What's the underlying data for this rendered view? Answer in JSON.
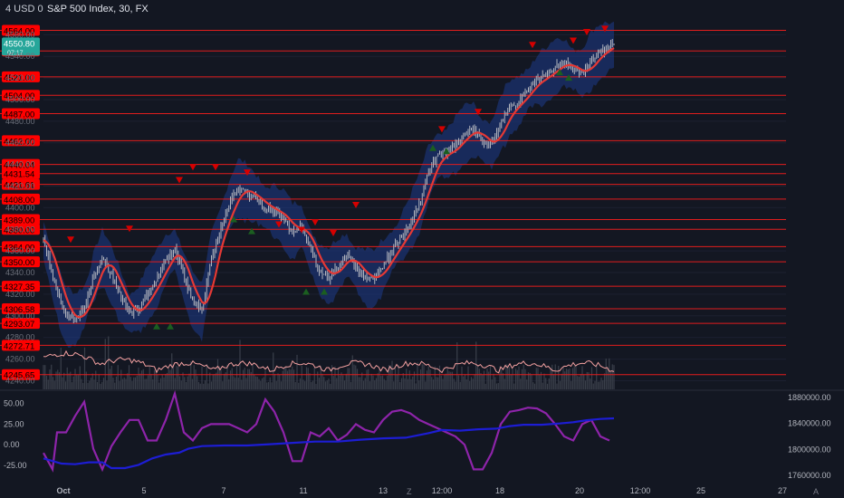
{
  "header": {
    "currency_label": "4 USD 0",
    "title": "S&P 500 Index, 30, FX"
  },
  "price_badge": {
    "value": "4550.80",
    "sub": "07:17"
  },
  "corner_labels": {
    "left": "Z",
    "right": "A"
  },
  "colors": {
    "background": "#131722",
    "level_line": "#e11d1d",
    "level_label_bg": "#ff0000",
    "price_badge_bg": "#26a69a",
    "candles": "#b2b5be",
    "moving_average": "#e53935",
    "band": "#1e3a8a",
    "oscillator": "#8e24aa",
    "volume_line": "#1d1dd4",
    "lower_histogram": "#f3a0a0",
    "marker_up": "#1b5e20",
    "marker_down": "#d50000"
  },
  "chart_data": {
    "type": "line",
    "title": "S&P 500 Index, 30, FX",
    "price_axis": {
      "ticks": [
        "4560.00",
        "4540.00",
        "4520.00",
        "4500.00",
        "4480.00",
        "4460.00",
        "4440.00",
        "4420.00",
        "4400.00",
        "4380.00",
        "4360.00",
        "4340.00",
        "4320.00",
        "4300.00",
        "4280.00",
        "4260.00",
        "4240.00"
      ]
    },
    "time_axis": {
      "ticks": [
        "Oct",
        "5",
        "7",
        "11",
        "13",
        "12:00",
        "18",
        "20",
        "12:00",
        "25",
        "27"
      ]
    },
    "horizontal_levels": [
      4564.0,
      4545.02,
      4521.0,
      4504.0,
      4487.0,
      4462.0,
      4440.04,
      4431.54,
      4421.61,
      4408.0,
      4389.0,
      4380.0,
      4364.0,
      4350.0,
      4327.35,
      4306.58,
      4293.07,
      4272.71,
      4245.65
    ],
    "horizontal_level_labels": [
      "4564.00",
      "4545.02",
      "4521.00",
      "4504.00",
      "4487.00",
      "4462.00",
      "4440.04",
      "4431.54",
      "4421.61",
      "4408.00",
      "4389.00",
      "4380.00",
      "4364.00",
      "4350.00",
      "4327.35",
      "4306.58",
      "4293.07",
      "4272.71",
      "4245.65"
    ],
    "price_series": [
      {
        "t": 0,
        "v": 4370
      },
      {
        "t": 2,
        "v": 4338
      },
      {
        "t": 4,
        "v": 4310
      },
      {
        "t": 5,
        "v": 4300
      },
      {
        "t": 7,
        "v": 4296
      },
      {
        "t": 9,
        "v": 4308
      },
      {
        "t": 11,
        "v": 4336
      },
      {
        "t": 13,
        "v": 4354
      },
      {
        "t": 15,
        "v": 4338
      },
      {
        "t": 17,
        "v": 4318
      },
      {
        "t": 19,
        "v": 4302
      },
      {
        "t": 21,
        "v": 4306
      },
      {
        "t": 23,
        "v": 4320
      },
      {
        "t": 25,
        "v": 4334
      },
      {
        "t": 27,
        "v": 4352
      },
      {
        "t": 29,
        "v": 4362
      },
      {
        "t": 31,
        "v": 4336
      },
      {
        "t": 33,
        "v": 4314
      },
      {
        "t": 35,
        "v": 4304
      },
      {
        "t": 37,
        "v": 4352
      },
      {
        "t": 39,
        "v": 4380
      },
      {
        "t": 41,
        "v": 4402
      },
      {
        "t": 43,
        "v": 4418
      },
      {
        "t": 45,
        "v": 4414
      },
      {
        "t": 47,
        "v": 4408
      },
      {
        "t": 49,
        "v": 4400
      },
      {
        "t": 51,
        "v": 4397
      },
      {
        "t": 53,
        "v": 4390
      },
      {
        "t": 55,
        "v": 4378
      },
      {
        "t": 57,
        "v": 4383
      },
      {
        "t": 59,
        "v": 4360
      },
      {
        "t": 61,
        "v": 4342
      },
      {
        "t": 63,
        "v": 4336
      },
      {
        "t": 65,
        "v": 4346
      },
      {
        "t": 67,
        "v": 4356
      },
      {
        "t": 69,
        "v": 4344
      },
      {
        "t": 71,
        "v": 4336
      },
      {
        "t": 73,
        "v": 4334
      },
      {
        "t": 75,
        "v": 4346
      },
      {
        "t": 77,
        "v": 4360
      },
      {
        "t": 79,
        "v": 4372
      },
      {
        "t": 81,
        "v": 4386
      },
      {
        "t": 83,
        "v": 4404
      },
      {
        "t": 85,
        "v": 4432
      },
      {
        "t": 87,
        "v": 4448
      },
      {
        "t": 89,
        "v": 4450
      },
      {
        "t": 91,
        "v": 4458
      },
      {
        "t": 93,
        "v": 4468
      },
      {
        "t": 95,
        "v": 4472
      },
      {
        "t": 97,
        "v": 4462
      },
      {
        "t": 99,
        "v": 4458
      },
      {
        "t": 101,
        "v": 4478
      },
      {
        "t": 103,
        "v": 4492
      },
      {
        "t": 105,
        "v": 4498
      },
      {
        "t": 107,
        "v": 4510
      },
      {
        "t": 109,
        "v": 4518
      },
      {
        "t": 111,
        "v": 4522
      },
      {
        "t": 113,
        "v": 4530
      },
      {
        "t": 115,
        "v": 4534
      },
      {
        "t": 117,
        "v": 4528
      },
      {
        "t": 119,
        "v": 4524
      },
      {
        "t": 121,
        "v": 4536
      },
      {
        "t": 123,
        "v": 4544
      },
      {
        "t": 125,
        "v": 4549
      },
      {
        "t": 126,
        "v": 4550.8
      }
    ],
    "oscillator_axis": {
      "ticks": [
        "50.00",
        "25.00",
        "0.00",
        "-25.00"
      ],
      "range": [
        -45,
        65
      ]
    },
    "volume_axis": {
      "ticks": [
        "1880000.00",
        "1840000.00",
        "1800000.00",
        "1760000.00"
      ],
      "range": [
        1750000,
        1890000
      ]
    },
    "oscillator_series": [
      {
        "t": 0,
        "v": -10
      },
      {
        "t": 2,
        "v": -30
      },
      {
        "t": 3,
        "v": 15
      },
      {
        "t": 5,
        "v": 15
      },
      {
        "t": 7,
        "v": 35
      },
      {
        "t": 9,
        "v": 52
      },
      {
        "t": 11,
        "v": -5
      },
      {
        "t": 13,
        "v": -30
      },
      {
        "t": 15,
        "v": -2
      },
      {
        "t": 17,
        "v": 15
      },
      {
        "t": 19,
        "v": 30
      },
      {
        "t": 21,
        "v": 30
      },
      {
        "t": 23,
        "v": 5
      },
      {
        "t": 25,
        "v": 5
      },
      {
        "t": 27,
        "v": 30
      },
      {
        "t": 29,
        "v": 62
      },
      {
        "t": 31,
        "v": 15
      },
      {
        "t": 33,
        "v": 5
      },
      {
        "t": 35,
        "v": 20
      },
      {
        "t": 37,
        "v": 25
      },
      {
        "t": 39,
        "v": 25
      },
      {
        "t": 41,
        "v": 25
      },
      {
        "t": 43,
        "v": 20
      },
      {
        "t": 45,
        "v": 15
      },
      {
        "t": 47,
        "v": 25
      },
      {
        "t": 49,
        "v": 55
      },
      {
        "t": 51,
        "v": 40
      },
      {
        "t": 53,
        "v": 15
      },
      {
        "t": 55,
        "v": -20
      },
      {
        "t": 57,
        "v": -20
      },
      {
        "t": 59,
        "v": 15
      },
      {
        "t": 61,
        "v": 10
      },
      {
        "t": 63,
        "v": 20
      },
      {
        "t": 65,
        "v": 5
      },
      {
        "t": 67,
        "v": 12
      },
      {
        "t": 69,
        "v": 25
      },
      {
        "t": 71,
        "v": 18
      },
      {
        "t": 73,
        "v": 15
      },
      {
        "t": 75,
        "v": 30
      },
      {
        "t": 77,
        "v": 40
      },
      {
        "t": 79,
        "v": 42
      },
      {
        "t": 81,
        "v": 38
      },
      {
        "t": 83,
        "v": 30
      },
      {
        "t": 85,
        "v": 25
      },
      {
        "t": 87,
        "v": 20
      },
      {
        "t": 89,
        "v": 15
      },
      {
        "t": 91,
        "v": 10
      },
      {
        "t": 93,
        "v": 0
      },
      {
        "t": 95,
        "v": -30
      },
      {
        "t": 97,
        "v": -30
      },
      {
        "t": 99,
        "v": -10
      },
      {
        "t": 101,
        "v": 25
      },
      {
        "t": 103,
        "v": 40
      },
      {
        "t": 105,
        "v": 42
      },
      {
        "t": 107,
        "v": 45
      },
      {
        "t": 109,
        "v": 44
      },
      {
        "t": 111,
        "v": 38
      },
      {
        "t": 113,
        "v": 25
      },
      {
        "t": 115,
        "v": 10
      },
      {
        "t": 117,
        "v": 5
      },
      {
        "t": 119,
        "v": 25
      },
      {
        "t": 121,
        "v": 30
      },
      {
        "t": 123,
        "v": 10
      },
      {
        "t": 125,
        "v": 5
      }
    ],
    "volume_series": [
      {
        "t": 0,
        "v": 1786000
      },
      {
        "t": 4,
        "v": 1778000
      },
      {
        "t": 7,
        "v": 1777000
      },
      {
        "t": 10,
        "v": 1780000
      },
      {
        "t": 13,
        "v": 1780000
      },
      {
        "t": 15,
        "v": 1771000
      },
      {
        "t": 18,
        "v": 1771000
      },
      {
        "t": 21,
        "v": 1776000
      },
      {
        "t": 24,
        "v": 1786000
      },
      {
        "t": 27,
        "v": 1792000
      },
      {
        "t": 30,
        "v": 1795000
      },
      {
        "t": 32,
        "v": 1801000
      },
      {
        "t": 35,
        "v": 1805000
      },
      {
        "t": 40,
        "v": 1806000
      },
      {
        "t": 45,
        "v": 1806000
      },
      {
        "t": 50,
        "v": 1808000
      },
      {
        "t": 55,
        "v": 1810000
      },
      {
        "t": 60,
        "v": 1812000
      },
      {
        "t": 65,
        "v": 1812000
      },
      {
        "t": 70,
        "v": 1815000
      },
      {
        "t": 75,
        "v": 1817000
      },
      {
        "t": 80,
        "v": 1818000
      },
      {
        "t": 85,
        "v": 1825000
      },
      {
        "t": 88,
        "v": 1830000
      },
      {
        "t": 92,
        "v": 1829000
      },
      {
        "t": 96,
        "v": 1831000
      },
      {
        "t": 100,
        "v": 1832000
      },
      {
        "t": 103,
        "v": 1836000
      },
      {
        "t": 106,
        "v": 1838000
      },
      {
        "t": 110,
        "v": 1838000
      },
      {
        "t": 114,
        "v": 1840000
      },
      {
        "t": 117,
        "v": 1842000
      },
      {
        "t": 120,
        "v": 1845000
      },
      {
        "t": 123,
        "v": 1847000
      },
      {
        "t": 126,
        "v": 1848000
      }
    ]
  }
}
